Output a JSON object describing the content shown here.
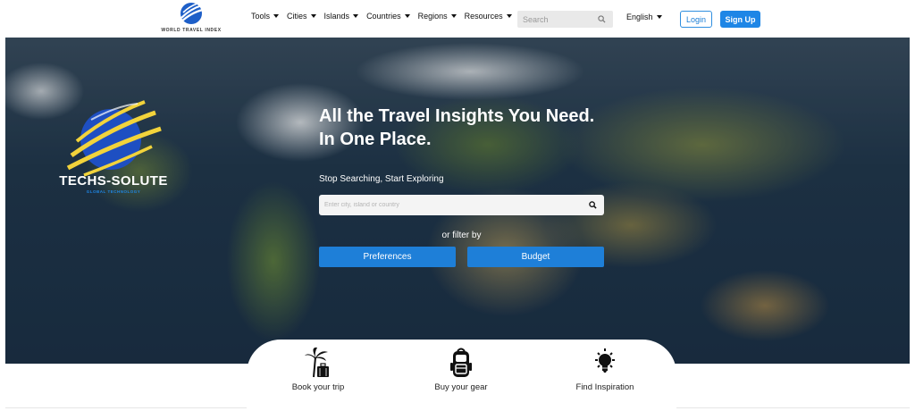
{
  "brand": {
    "name": "WORLD TRAVEL INDEX",
    "accent": "#1e86e6"
  },
  "nav": {
    "items": [
      {
        "label": "Tools"
      },
      {
        "label": "Cities"
      },
      {
        "label": "Islands"
      },
      {
        "label": "Countries"
      },
      {
        "label": "Regions"
      },
      {
        "label": "Resources"
      }
    ]
  },
  "search": {
    "placeholder": "Search",
    "icon": "search-icon"
  },
  "language": {
    "selected": "English"
  },
  "auth": {
    "login_label": "Login",
    "signup_label": "Sign Up"
  },
  "hero": {
    "logo_name": "TECHS-SOLUTE",
    "logo_tagline": "GLOBAL TECHNOLOGY",
    "headline_line1": "All the Travel Insights You Need.",
    "headline_line2": "In One Place.",
    "subhead": "Stop Searching, Start Exploring",
    "search_placeholder": "Enter city, island or country",
    "or_filter": "or filter by",
    "buttons": {
      "preferences": "Preferences",
      "budget": "Budget"
    },
    "button_color": "#1e7fd8"
  },
  "features": [
    {
      "label": "Book your trip",
      "icon": "palm-suitcase-icon"
    },
    {
      "label": "Buy your gear",
      "icon": "backpack-icon"
    },
    {
      "label": "Find Inspiration",
      "icon": "lightbulb-icon"
    }
  ]
}
